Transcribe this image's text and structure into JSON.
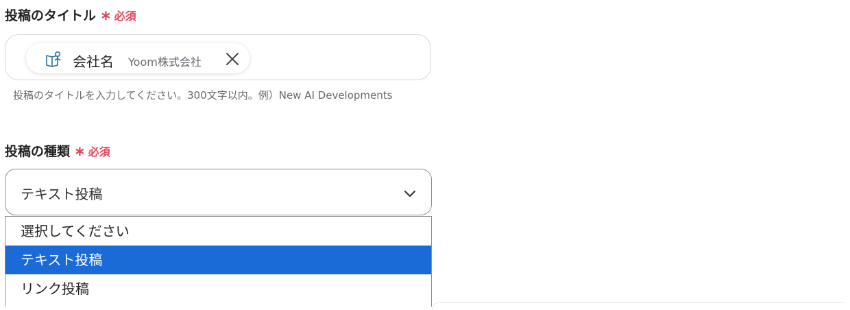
{
  "title_field": {
    "label": "投稿のタイトル",
    "asterisk": "∗",
    "required": "必須",
    "chip": {
      "icon": "book-person-icon",
      "name": "会社名",
      "value": "Yoom株式会社",
      "close_icon": "close-icon"
    },
    "help": "投稿のタイトルを入力してください。300文字以内。例）New AI Developments"
  },
  "type_field": {
    "label": "投稿の種類",
    "asterisk": "∗",
    "required": "必須",
    "selected_value": "テキスト投稿",
    "chevron_icon": "chevron-down-icon",
    "options": [
      {
        "label": "選択してください",
        "selected": false
      },
      {
        "label": "テキスト投稿",
        "selected": true
      },
      {
        "label": "リンク投稿",
        "selected": false
      }
    ]
  },
  "colors": {
    "required_red": "#e5475b",
    "highlight_blue": "#1a6ad7"
  }
}
